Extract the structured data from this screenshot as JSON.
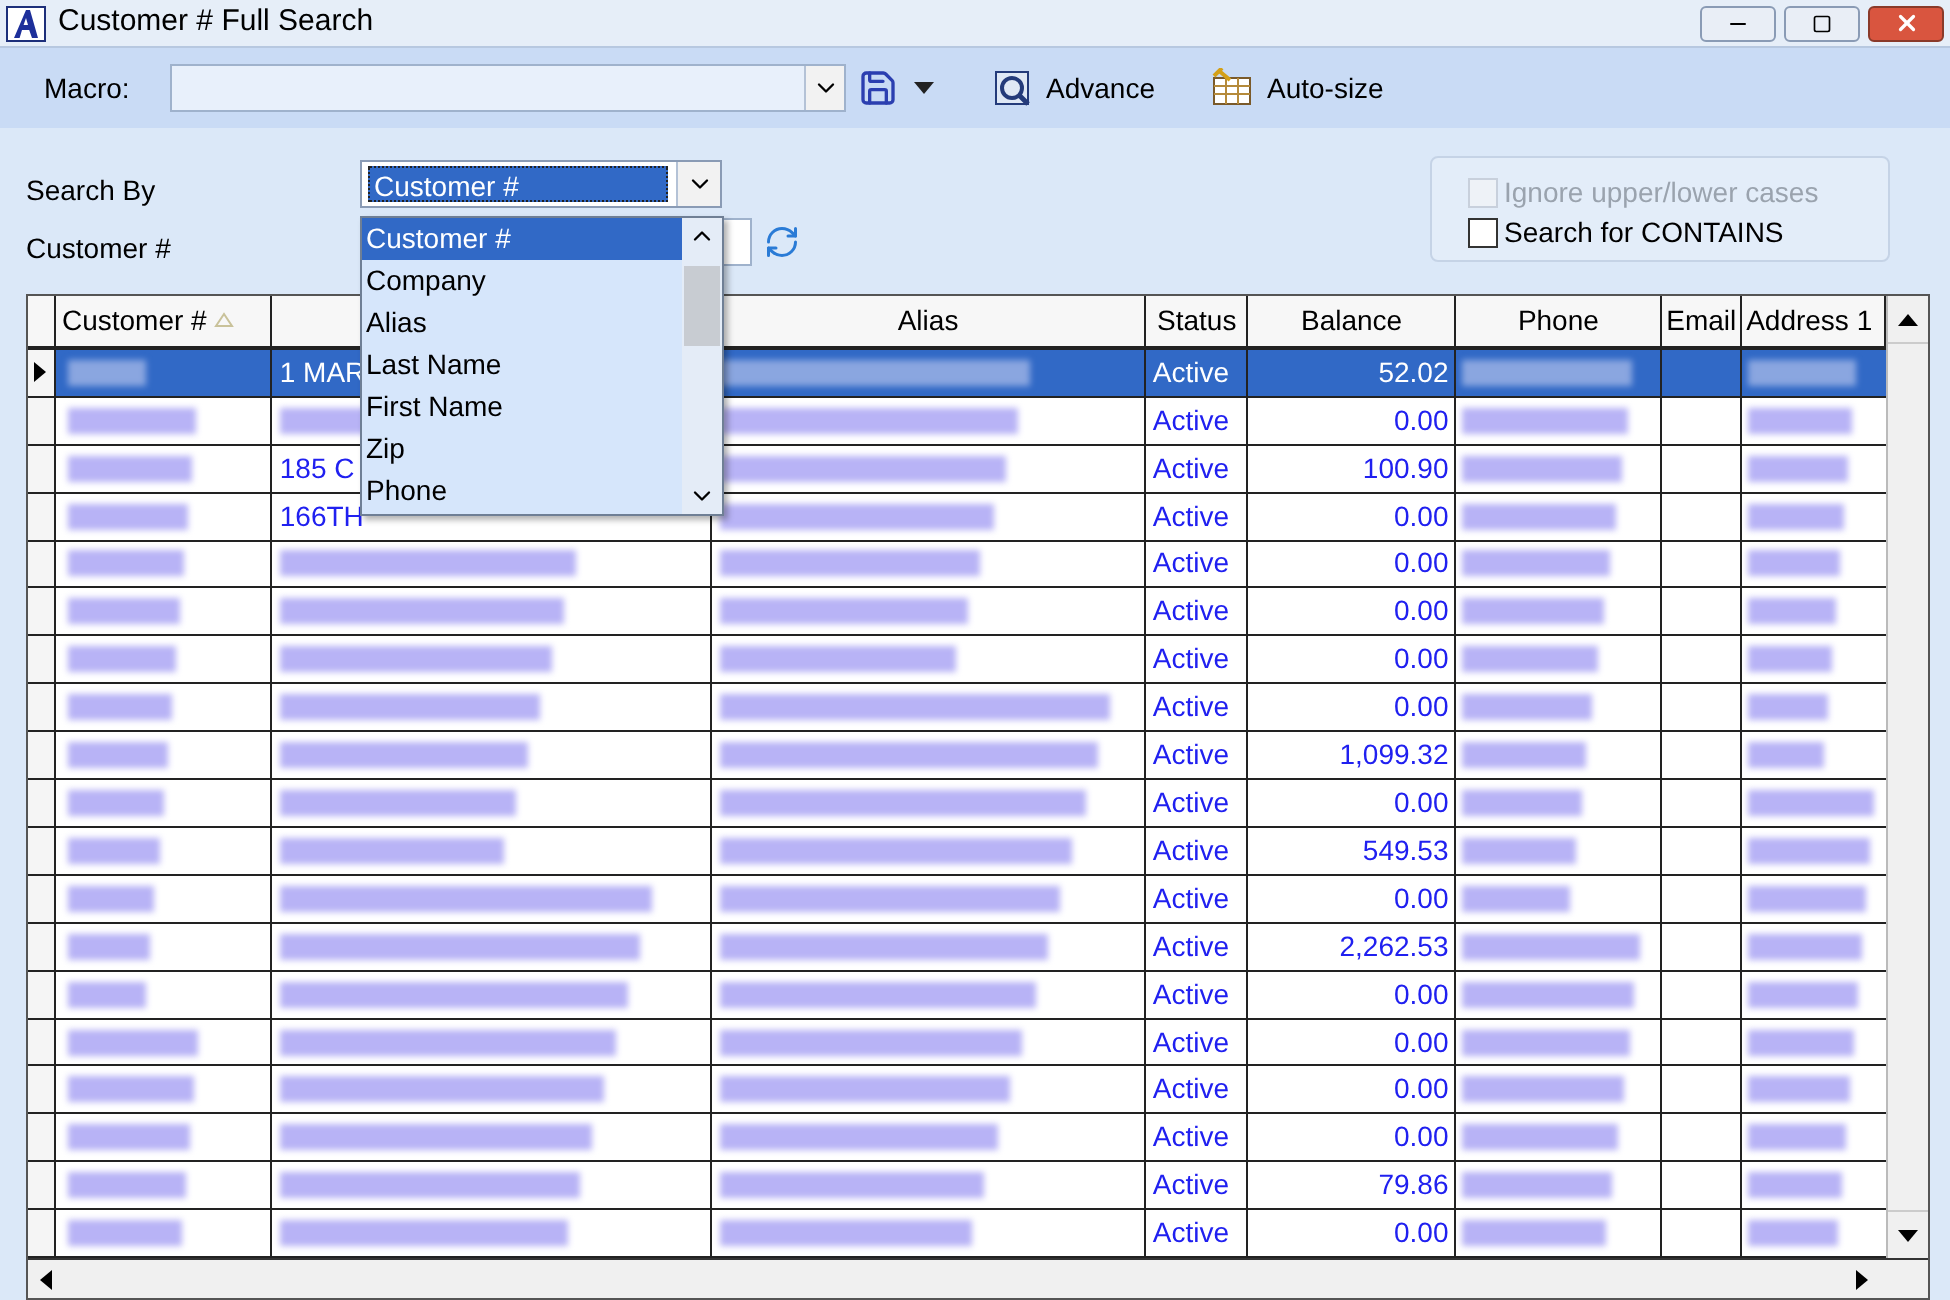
{
  "window": {
    "title": "Customer # Full Search"
  },
  "toolbar": {
    "macro_label": "Macro:",
    "buttons": [
      {
        "label": "Advance",
        "kind": "advance"
      },
      {
        "label": "Auto-size",
        "kind": "autosize"
      }
    ]
  },
  "search": {
    "search_by_label": "Search By",
    "search_by_value": "Customer #",
    "field_label": "Customer #",
    "dropdown_items": [
      {
        "label": "Customer #",
        "selected": true
      },
      {
        "label": "Company",
        "selected": false
      },
      {
        "label": "Alias",
        "selected": false
      },
      {
        "label": "Last Name",
        "selected": false
      },
      {
        "label": "First Name",
        "selected": false
      },
      {
        "label": "Zip",
        "selected": false
      },
      {
        "label": "Phone",
        "selected": false
      }
    ],
    "options": [
      {
        "label": "Ignore upper/lower cases",
        "checked": false,
        "disabled": true
      },
      {
        "label": "Search for CONTAINS",
        "checked": false,
        "disabled": false
      }
    ]
  },
  "table": {
    "columns": [
      {
        "label": "Customer #",
        "sorted": true
      },
      {
        "sorted": false
      },
      {
        "label": "Alias",
        "sorted": false
      },
      {
        "label": "Status",
        "sorted": false
      },
      {
        "label": "Balance",
        "sorted": false
      },
      {
        "label": "Phone",
        "sorted": false
      },
      {
        "label": "Email",
        "sorted": false
      },
      {
        "label": "Address 1",
        "sorted": false
      }
    ],
    "rows": [
      {
        "selected": true,
        "company": "1 MAR",
        "status": "Active",
        "balance": "52.02"
      },
      {
        "selected": false,
        "status": "Active",
        "balance": "0.00"
      },
      {
        "selected": false,
        "company": "185 C",
        "status": "Active",
        "balance": "100.90"
      },
      {
        "selected": false,
        "company": "166TH",
        "status": "Active",
        "balance": "0.00"
      },
      {
        "selected": false,
        "status": "Active",
        "balance": "0.00"
      },
      {
        "selected": false,
        "status": "Active",
        "balance": "0.00"
      },
      {
        "selected": false,
        "status": "Active",
        "balance": "0.00"
      },
      {
        "selected": false,
        "status": "Active",
        "balance": "0.00"
      },
      {
        "selected": false,
        "status": "Active",
        "balance": "1,099.32"
      },
      {
        "selected": false,
        "status": "Active",
        "balance": "0.00"
      },
      {
        "selected": false,
        "status": "Active",
        "balance": "549.53"
      },
      {
        "selected": false,
        "status": "Active",
        "balance": "0.00"
      },
      {
        "selected": false,
        "status": "Active",
        "balance": "2,262.53"
      },
      {
        "selected": false,
        "status": "Active",
        "balance": "0.00"
      },
      {
        "selected": false,
        "status": "Active",
        "balance": "0.00"
      },
      {
        "selected": false,
        "status": "Active",
        "balance": "0.00"
      },
      {
        "selected": false,
        "status": "Active",
        "balance": "0.00"
      },
      {
        "selected": false,
        "status": "Active",
        "balance": "79.86"
      },
      {
        "selected": false,
        "status": "Active",
        "balance": "0.00"
      }
    ]
  }
}
